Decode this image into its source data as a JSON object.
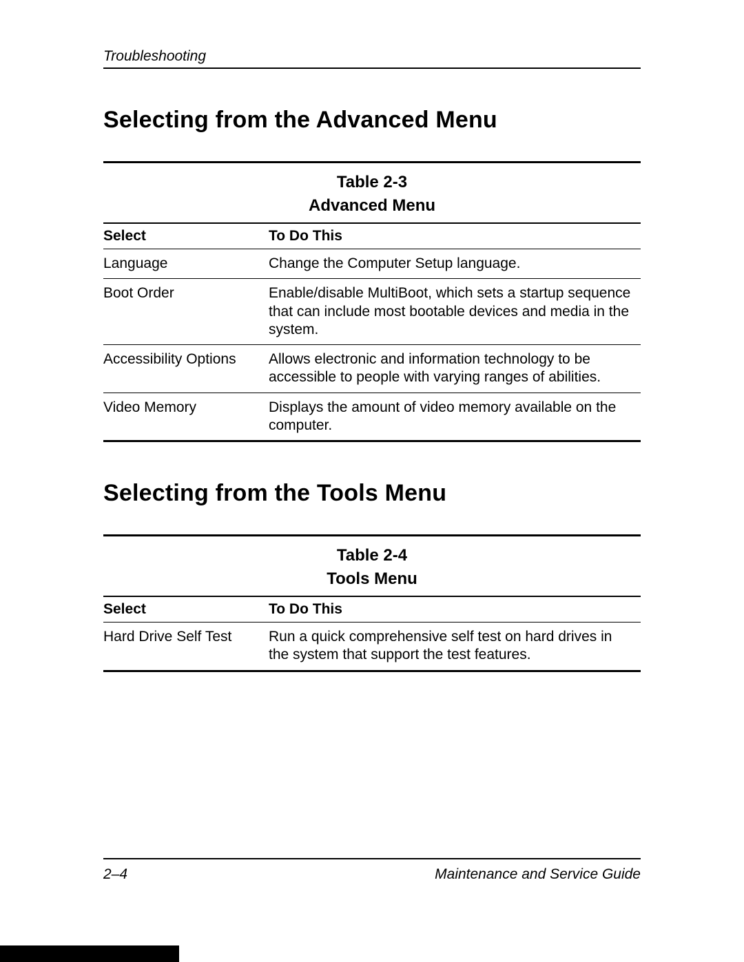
{
  "header": {
    "running": "Troubleshooting"
  },
  "sections": {
    "advanced": {
      "heading": "Selecting from the Advanced Menu",
      "table": {
        "caption": "Table 2-3",
        "title": "Advanced Menu",
        "head_select": "Select",
        "head_action": "To Do This",
        "rows": [
          {
            "select": "Language",
            "action": "Change the Computer Setup language."
          },
          {
            "select": "Boot Order",
            "action": "Enable/disable MultiBoot, which sets a startup sequence that can include most bootable devices and media in the system."
          },
          {
            "select": "Accessibility Options",
            "action": "Allows electronic and information technology to be accessible to people with varying ranges of abilities."
          },
          {
            "select": "Video Memory",
            "action": "Displays the amount of video memory available on the computer."
          }
        ]
      }
    },
    "tools": {
      "heading": "Selecting from the Tools Menu",
      "table": {
        "caption": "Table 2-4",
        "title": "Tools Menu",
        "head_select": "Select",
        "head_action": "To Do This",
        "rows": [
          {
            "select": "Hard Drive Self Test",
            "action": "Run a quick comprehensive self test on hard drives in the system that support the test features."
          }
        ]
      }
    }
  },
  "footer": {
    "page_num": "2–4",
    "book_title": "Maintenance and Service Guide"
  }
}
